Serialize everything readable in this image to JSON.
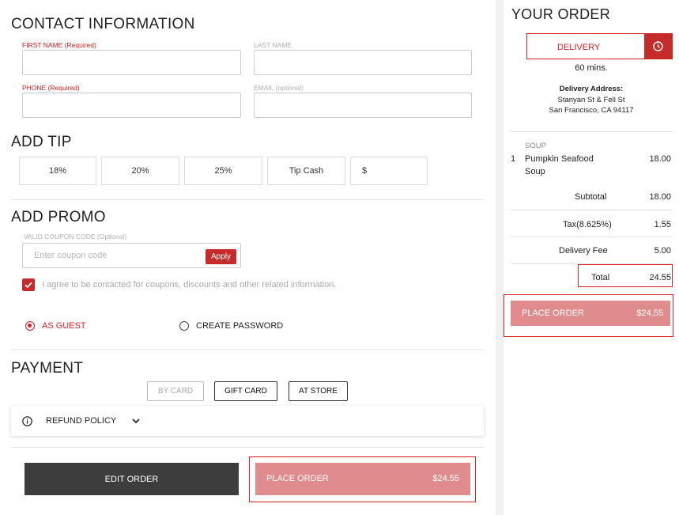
{
  "contact": {
    "title": "CONTACT INFORMATION",
    "first_name_label": "FIRST NAME (Required)",
    "last_name_label": "LAST NAME",
    "phone_label": "PHONE (Required)",
    "email_label": "EMAIL (optional)"
  },
  "tip": {
    "title": "ADD TIP",
    "options": [
      "18%",
      "20%",
      "25%",
      "Tip Cash"
    ],
    "custom_prefix": "$"
  },
  "promo": {
    "title": "ADD PROMO",
    "code_label": "VALID COUPON CODE (Optional)",
    "placeholder": "Enter coupon code",
    "apply_label": "Apply",
    "consent_text": "I agree to be contacted for coupons, discounts and other related information."
  },
  "account": {
    "guest_label": "AS GUEST",
    "create_password_label": "CREATE PASSWORD"
  },
  "payment": {
    "title": "PAYMENT",
    "by_card": "BY CARD",
    "gift_card": "GIFT CARD",
    "at_store": "AT STORE",
    "refund_policy": "REFUND POLICY"
  },
  "actions": {
    "edit_order": "EDIT ORDER",
    "place_order": "PLACE ORDER",
    "total": "$24.55"
  },
  "order": {
    "title": "YOUR ORDER",
    "mode": "DELIVERY",
    "eta": "60 mins.",
    "address_label": "Delivery Address:",
    "address_line1": "Stanyan St & Fell St",
    "address_line2": "San Francisco, CA 94117",
    "category": "SOUP",
    "item_qty": "1",
    "item_name_line1": "Pumpkin Seafood",
    "item_name_line2": "Soup",
    "item_price": "18.00",
    "subtotal_label": "Subtotal",
    "subtotal": "18.00",
    "tax_label": "Tax(8.625%)",
    "tax": "1.55",
    "delivery_fee_label": "Delivery Fee",
    "delivery_fee": "5.00",
    "total_label": "Total",
    "total": "24.55",
    "place_order": "PLACE ORDER",
    "place_total": "$24.55"
  },
  "colors": {
    "accent": "#c62b2b",
    "place_order_bg": "#e08c8c",
    "edit_order_bg": "#3d3d3d"
  }
}
